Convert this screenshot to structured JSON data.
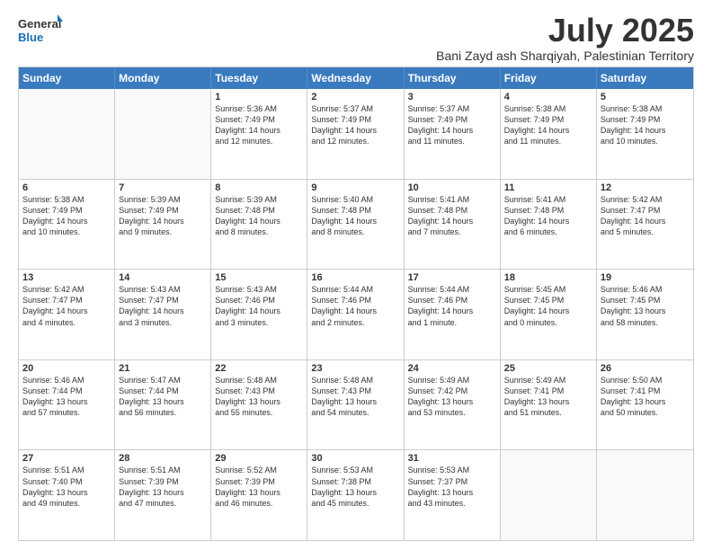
{
  "logo": {
    "line1": "General",
    "line2": "Blue"
  },
  "title": "July 2025",
  "location": "Bani Zayd ash Sharqiyah, Palestinian Territory",
  "days": [
    "Sunday",
    "Monday",
    "Tuesday",
    "Wednesday",
    "Thursday",
    "Friday",
    "Saturday"
  ],
  "weeks": [
    [
      {
        "day": "",
        "info": ""
      },
      {
        "day": "",
        "info": ""
      },
      {
        "day": "1",
        "info": "Sunrise: 5:36 AM\nSunset: 7:49 PM\nDaylight: 14 hours\nand 12 minutes."
      },
      {
        "day": "2",
        "info": "Sunrise: 5:37 AM\nSunset: 7:49 PM\nDaylight: 14 hours\nand 12 minutes."
      },
      {
        "day": "3",
        "info": "Sunrise: 5:37 AM\nSunset: 7:49 PM\nDaylight: 14 hours\nand 11 minutes."
      },
      {
        "day": "4",
        "info": "Sunrise: 5:38 AM\nSunset: 7:49 PM\nDaylight: 14 hours\nand 11 minutes."
      },
      {
        "day": "5",
        "info": "Sunrise: 5:38 AM\nSunset: 7:49 PM\nDaylight: 14 hours\nand 10 minutes."
      }
    ],
    [
      {
        "day": "6",
        "info": "Sunrise: 5:38 AM\nSunset: 7:49 PM\nDaylight: 14 hours\nand 10 minutes."
      },
      {
        "day": "7",
        "info": "Sunrise: 5:39 AM\nSunset: 7:49 PM\nDaylight: 14 hours\nand 9 minutes."
      },
      {
        "day": "8",
        "info": "Sunrise: 5:39 AM\nSunset: 7:48 PM\nDaylight: 14 hours\nand 8 minutes."
      },
      {
        "day": "9",
        "info": "Sunrise: 5:40 AM\nSunset: 7:48 PM\nDaylight: 14 hours\nand 8 minutes."
      },
      {
        "day": "10",
        "info": "Sunrise: 5:41 AM\nSunset: 7:48 PM\nDaylight: 14 hours\nand 7 minutes."
      },
      {
        "day": "11",
        "info": "Sunrise: 5:41 AM\nSunset: 7:48 PM\nDaylight: 14 hours\nand 6 minutes."
      },
      {
        "day": "12",
        "info": "Sunrise: 5:42 AM\nSunset: 7:47 PM\nDaylight: 14 hours\nand 5 minutes."
      }
    ],
    [
      {
        "day": "13",
        "info": "Sunrise: 5:42 AM\nSunset: 7:47 PM\nDaylight: 14 hours\nand 4 minutes."
      },
      {
        "day": "14",
        "info": "Sunrise: 5:43 AM\nSunset: 7:47 PM\nDaylight: 14 hours\nand 3 minutes."
      },
      {
        "day": "15",
        "info": "Sunrise: 5:43 AM\nSunset: 7:46 PM\nDaylight: 14 hours\nand 3 minutes."
      },
      {
        "day": "16",
        "info": "Sunrise: 5:44 AM\nSunset: 7:46 PM\nDaylight: 14 hours\nand 2 minutes."
      },
      {
        "day": "17",
        "info": "Sunrise: 5:44 AM\nSunset: 7:46 PM\nDaylight: 14 hours\nand 1 minute."
      },
      {
        "day": "18",
        "info": "Sunrise: 5:45 AM\nSunset: 7:45 PM\nDaylight: 14 hours\nand 0 minutes."
      },
      {
        "day": "19",
        "info": "Sunrise: 5:46 AM\nSunset: 7:45 PM\nDaylight: 13 hours\nand 58 minutes."
      }
    ],
    [
      {
        "day": "20",
        "info": "Sunrise: 5:46 AM\nSunset: 7:44 PM\nDaylight: 13 hours\nand 57 minutes."
      },
      {
        "day": "21",
        "info": "Sunrise: 5:47 AM\nSunset: 7:44 PM\nDaylight: 13 hours\nand 56 minutes."
      },
      {
        "day": "22",
        "info": "Sunrise: 5:48 AM\nSunset: 7:43 PM\nDaylight: 13 hours\nand 55 minutes."
      },
      {
        "day": "23",
        "info": "Sunrise: 5:48 AM\nSunset: 7:43 PM\nDaylight: 13 hours\nand 54 minutes."
      },
      {
        "day": "24",
        "info": "Sunrise: 5:49 AM\nSunset: 7:42 PM\nDaylight: 13 hours\nand 53 minutes."
      },
      {
        "day": "25",
        "info": "Sunrise: 5:49 AM\nSunset: 7:41 PM\nDaylight: 13 hours\nand 51 minutes."
      },
      {
        "day": "26",
        "info": "Sunrise: 5:50 AM\nSunset: 7:41 PM\nDaylight: 13 hours\nand 50 minutes."
      }
    ],
    [
      {
        "day": "27",
        "info": "Sunrise: 5:51 AM\nSunset: 7:40 PM\nDaylight: 13 hours\nand 49 minutes."
      },
      {
        "day": "28",
        "info": "Sunrise: 5:51 AM\nSunset: 7:39 PM\nDaylight: 13 hours\nand 47 minutes."
      },
      {
        "day": "29",
        "info": "Sunrise: 5:52 AM\nSunset: 7:39 PM\nDaylight: 13 hours\nand 46 minutes."
      },
      {
        "day": "30",
        "info": "Sunrise: 5:53 AM\nSunset: 7:38 PM\nDaylight: 13 hours\nand 45 minutes."
      },
      {
        "day": "31",
        "info": "Sunrise: 5:53 AM\nSunset: 7:37 PM\nDaylight: 13 hours\nand 43 minutes."
      },
      {
        "day": "",
        "info": ""
      },
      {
        "day": "",
        "info": ""
      }
    ]
  ]
}
